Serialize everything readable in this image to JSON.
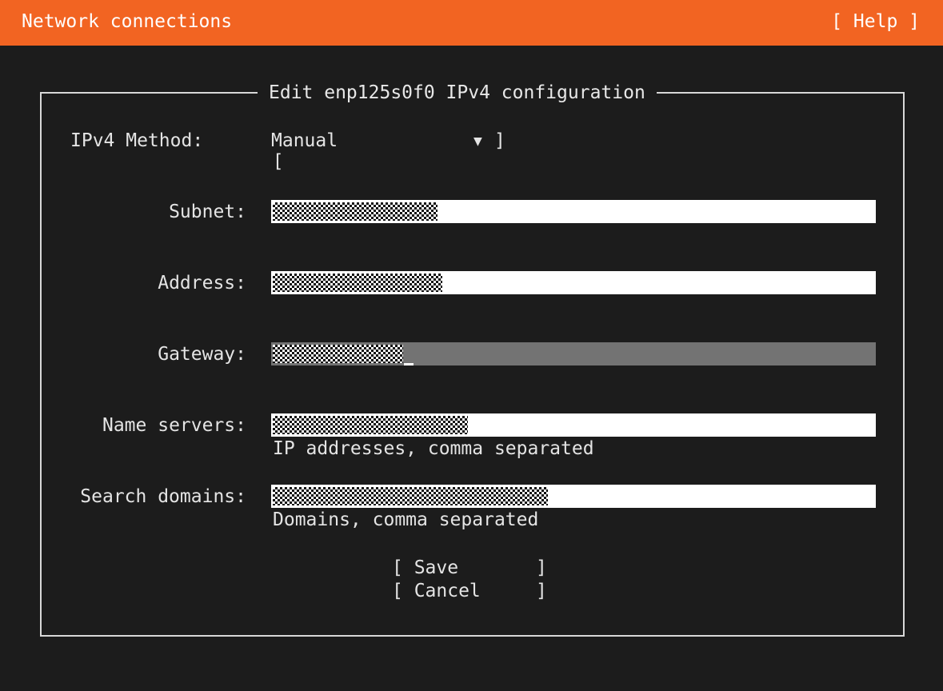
{
  "header": {
    "title": "Network connections",
    "help_label": "[ Help ]"
  },
  "dialog": {
    "title": "Edit enp125s0f0 IPv4 configuration",
    "method": {
      "label": "IPv4 Method:",
      "open_bracket": "[",
      "value": "Manual",
      "arrow": "▼",
      "close_bracket": "]"
    },
    "fields": {
      "subnet_label": "Subnet:",
      "address_label": "Address:",
      "gateway_label": "Gateway:",
      "nameservers_label": "Name servers:",
      "nameservers_hint": "IP addresses, comma separated",
      "searchdomains_label": "Search domains:",
      "searchdomains_hint": "Domains, comma separated"
    },
    "buttons": {
      "save": "[ Save       ]",
      "cancel": "[ Cancel     ]"
    }
  },
  "colors": {
    "header_bg": "#f26422",
    "background": "#1c1c1c",
    "focused_field": "#737373"
  }
}
